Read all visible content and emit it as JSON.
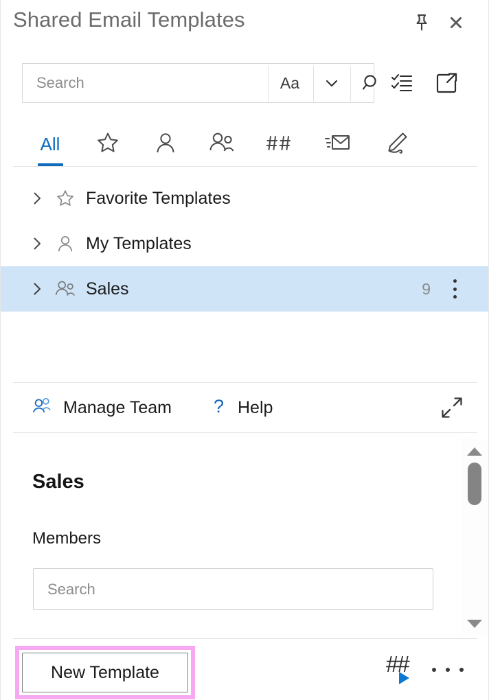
{
  "window": {
    "title": "Shared Email Templates",
    "pin_icon": "pin-icon",
    "close_icon": "close-icon"
  },
  "search": {
    "placeholder": "Search",
    "value": "",
    "match_case_label": "Aa",
    "dropdown_icon": "chevron-down-icon",
    "search_icon": "magnifier-icon",
    "checklist_icon": "checklist-icon",
    "popout_icon": "open-in-new-window-icon"
  },
  "tabs": [
    {
      "label": "All",
      "icon": "all-text",
      "active": true
    },
    {
      "label": "",
      "icon": "star-icon",
      "active": false
    },
    {
      "label": "",
      "icon": "person-icon",
      "active": false
    },
    {
      "label": "",
      "icon": "team-icon",
      "active": false
    },
    {
      "label": "",
      "icon": "hashtags-icon",
      "active": false
    },
    {
      "label": "",
      "icon": "incoming-mail-icon",
      "active": false
    },
    {
      "label": "",
      "icon": "signature-pen-icon",
      "active": false
    }
  ],
  "tree": [
    {
      "label": "Favorite Templates",
      "icon": "star-icon",
      "chevron": "chevron-right-icon",
      "count": "",
      "selected": false
    },
    {
      "label": "My Templates",
      "icon": "person-icon",
      "chevron": "chevron-right-icon",
      "count": "",
      "selected": false
    },
    {
      "label": "Sales",
      "icon": "team-icon",
      "chevron": "chevron-right-icon",
      "count": "9",
      "selected": true
    }
  ],
  "actions": {
    "manage_team_label": "Manage Team",
    "manage_team_icon": "team-icon",
    "help_label": "Help",
    "help_icon": "question-mark-icon",
    "expand_icon": "expand-diagonal-icon"
  },
  "detail": {
    "title": "Sales",
    "members_label": "Members",
    "members_search_placeholder": "Search",
    "members_search_value": ""
  },
  "scrollbar": {
    "up_icon": "scroll-up-arrow-icon",
    "down_icon": "scroll-down-arrow-icon",
    "thumb": "scrollbar-thumb"
  },
  "bottom": {
    "new_template_label": "New Template",
    "hash_label": "##",
    "hash_run_icon": "run-macro-icon",
    "more_icon": "ellipsis-icon"
  },
  "colors": {
    "accent_blue": "#0f6cbd",
    "selected_row": "#cfe4f7",
    "highlight_pink": "#f6a9f0",
    "title_gray": "#6b6b6b",
    "divider": "#e3e3e3"
  }
}
